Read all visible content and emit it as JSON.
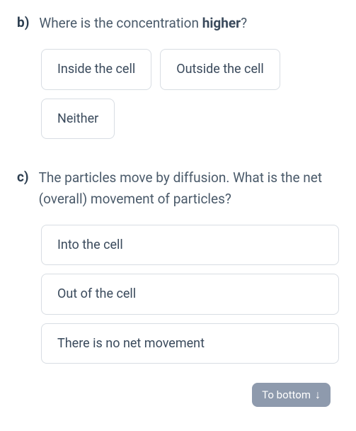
{
  "questions": {
    "b": {
      "label": "b)",
      "text_before": "Where is the concentration ",
      "text_bold": "higher",
      "text_after": "?",
      "options": [
        "Inside the cell",
        "Outside the cell",
        "Neither"
      ]
    },
    "c": {
      "label": "c)",
      "text": "The particles move by diffusion. What is the net (overall) movement of particles?",
      "options": [
        "Into the cell",
        "Out of the cell",
        "There is no net movement"
      ]
    }
  },
  "toBottom": {
    "label": "To bottom",
    "icon": "↓"
  }
}
